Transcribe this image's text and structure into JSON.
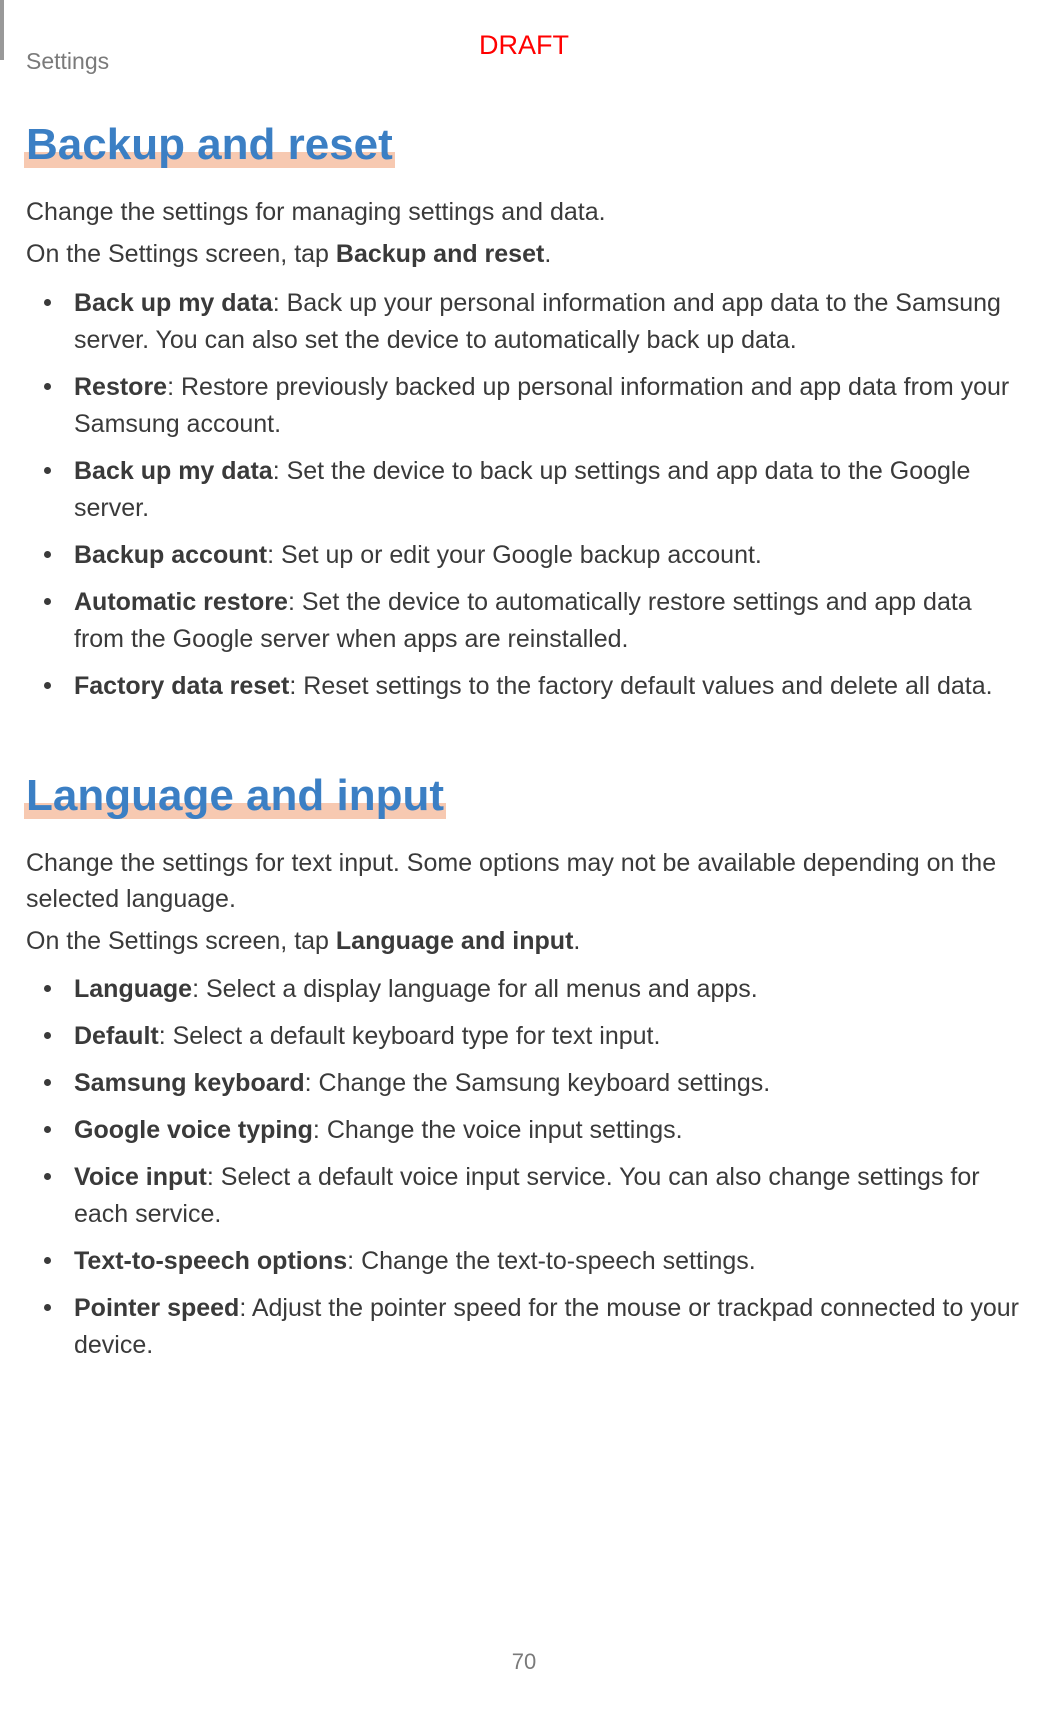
{
  "header": {
    "label": "Settings",
    "draft": "DRAFT"
  },
  "sections": [
    {
      "heading": "Backup and reset",
      "intro": "Change the settings for managing settings and data.",
      "tap_prefix": "On the Settings screen, tap ",
      "tap_bold": "Backup and reset",
      "tap_suffix": ".",
      "items": [
        {
          "bold": "Back up my data",
          "text": ": Back up your personal information and app data to the Samsung server. You can also set the device to automatically back up data."
        },
        {
          "bold": "Restore",
          "text": ": Restore previously backed up personal information and app data from your Samsung account."
        },
        {
          "bold": "Back up my data",
          "text": ": Set the device to back up settings and app data to the Google server."
        },
        {
          "bold": "Backup account",
          "text": ": Set up or edit your Google backup account."
        },
        {
          "bold": "Automatic restore",
          "text": ": Set the device to automatically restore settings and app data from the Google server when apps are reinstalled."
        },
        {
          "bold": "Factory data reset",
          "text": ": Reset settings to the factory default values and delete all data."
        }
      ]
    },
    {
      "heading": "Language and input",
      "intro": "Change the settings for text input. Some options may not be available depending on the selected language.",
      "tap_prefix": "On the Settings screen, tap ",
      "tap_bold": "Language and input",
      "tap_suffix": ".",
      "items": [
        {
          "bold": "Language",
          "text": ": Select a display language for all menus and apps."
        },
        {
          "bold": "Default",
          "text": ": Select a default keyboard type for text input."
        },
        {
          "bold": "Samsung keyboard",
          "text": ": Change the Samsung keyboard settings."
        },
        {
          "bold": "Google voice typing",
          "text": ": Change the voice input settings."
        },
        {
          "bold": "Voice input",
          "text": ": Select a default voice input service. You can also change settings for each service."
        },
        {
          "bold": "Text-to-speech options",
          "text": ": Change the text-to-speech settings."
        },
        {
          "bold": "Pointer speed",
          "text": ": Adjust the pointer speed for the mouse or trackpad connected to your device."
        }
      ]
    }
  ],
  "page_number": "70"
}
